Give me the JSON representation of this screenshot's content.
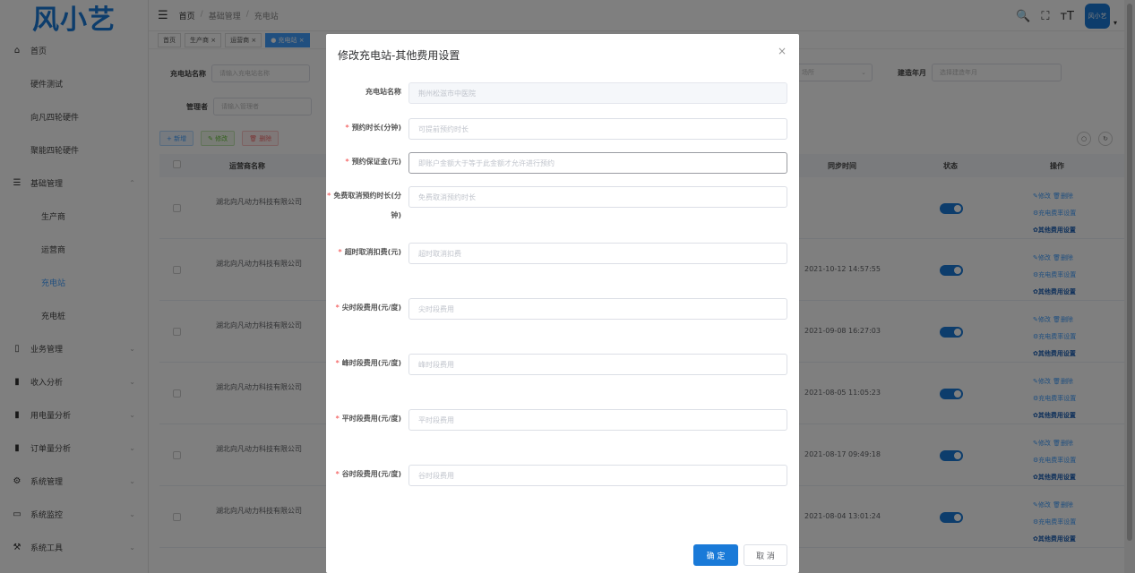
{
  "logo": "风小艺",
  "sidebar": {
    "items": [
      {
        "label": "首页",
        "icon": "home-icon",
        "level": 0
      },
      {
        "label": "硬件测试",
        "level": 1
      },
      {
        "label": "向凡四轮硬件",
        "level": 1
      },
      {
        "label": "聚能四轮硬件",
        "level": 1
      },
      {
        "label": "基础管理",
        "icon": "list-icon",
        "level": 0,
        "expanded": true
      },
      {
        "label": "生产商",
        "level": 2
      },
      {
        "label": "运营商",
        "level": 2
      },
      {
        "label": "充电站",
        "level": 2,
        "active": true
      },
      {
        "label": "充电桩",
        "level": 2
      },
      {
        "label": "业务管理",
        "icon": "phone-icon",
        "level": 0
      },
      {
        "label": "收入分析",
        "icon": "bar-chart-icon",
        "level": 0
      },
      {
        "label": "用电量分析",
        "icon": "bar-chart-icon",
        "level": 0
      },
      {
        "label": "订单量分析",
        "icon": "bar-chart-icon",
        "level": 0
      },
      {
        "label": "系统管理",
        "icon": "gear-icon",
        "level": 0
      },
      {
        "label": "系统监控",
        "icon": "monitor-icon",
        "level": 0
      },
      {
        "label": "系统工具",
        "icon": "tool-icon",
        "level": 0
      }
    ]
  },
  "breadcrumb": {
    "home": "首页",
    "level1": "基础管理",
    "level2": "充电站"
  },
  "avatar_text": "风小艺",
  "tags": [
    {
      "label": "首页",
      "active": false
    },
    {
      "label": "生产商 ×",
      "active": false
    },
    {
      "label": "运营商 ×",
      "active": false
    },
    {
      "label": "● 充电站 ×",
      "active": true
    }
  ],
  "filters": {
    "station_label": "充电站名称",
    "station_placeholder": "请输入充电站名称",
    "manager_label": "管理者",
    "manager_placeholder": "请输入管理者",
    "site_placeholder": "场所",
    "build_label": "建造年月",
    "build_placeholder": "选择建造年月"
  },
  "toolbar": {
    "add": "+ 新增",
    "edit": "✎ 修改",
    "delete": "🗑 删除"
  },
  "table": {
    "headers": {
      "operator": "运营商名称",
      "sync": "同步时间",
      "status": "状态",
      "ops": "操作"
    },
    "ops_labels": {
      "edit": "✎修改",
      "delete": "🗑删除",
      "rate": "⚙充电费率设置",
      "other": "✿其他费用设置"
    },
    "rows": [
      {
        "company": "湖北向凡动力科技有限公司",
        "time": ""
      },
      {
        "company": "湖北向凡动力科技有限公司",
        "time": "2021-10-12 14:57:55"
      },
      {
        "company": "湖北向凡动力科技有限公司",
        "time": "2021-09-08 16:27:03"
      },
      {
        "company": "湖北向凡动力科技有限公司",
        "time": "2021-08-05 11:05:23"
      },
      {
        "company": "湖北向凡动力科技有限公司",
        "time": "2021-08-17 09:49:18"
      },
      {
        "company": "湖北向凡动力科技有限公司",
        "time": "2021-08-04 13:01:24"
      }
    ]
  },
  "dialog": {
    "title": "修改充电站-其他费用设置",
    "close": "×",
    "fields": [
      {
        "label": "充电站名称",
        "required": false,
        "value": "荆州松滋市中医院",
        "disabled": true
      },
      {
        "label": "预约时长(分钟)",
        "required": true,
        "placeholder": "可提前预约时长"
      },
      {
        "label": "预约保证金(元)",
        "required": true,
        "placeholder": "即账户金额大于等于此金额才允许进行预约"
      },
      {
        "label": "免费取消预约时长(分钟)",
        "required": true,
        "placeholder": "免费取消预约时长"
      },
      {
        "label": "超时取消扣费(元)",
        "required": true,
        "placeholder": "超时取消扣费"
      },
      {
        "label": "尖时段费用(元/度)",
        "required": true,
        "placeholder": "尖时段费用"
      },
      {
        "label": "峰时段费用(元/度)",
        "required": true,
        "placeholder": "峰时段费用"
      },
      {
        "label": "平时段费用(元/度)",
        "required": true,
        "placeholder": "平时段费用"
      },
      {
        "label": "谷时段费用(元/度)",
        "required": true,
        "placeholder": "谷时段费用"
      }
    ],
    "ok": "确 定",
    "cancel": "取 消"
  },
  "colors": {
    "primary": "#1a7ad8",
    "accent": "#409eff",
    "danger": "#f56c6c",
    "success": "#67c23a"
  }
}
